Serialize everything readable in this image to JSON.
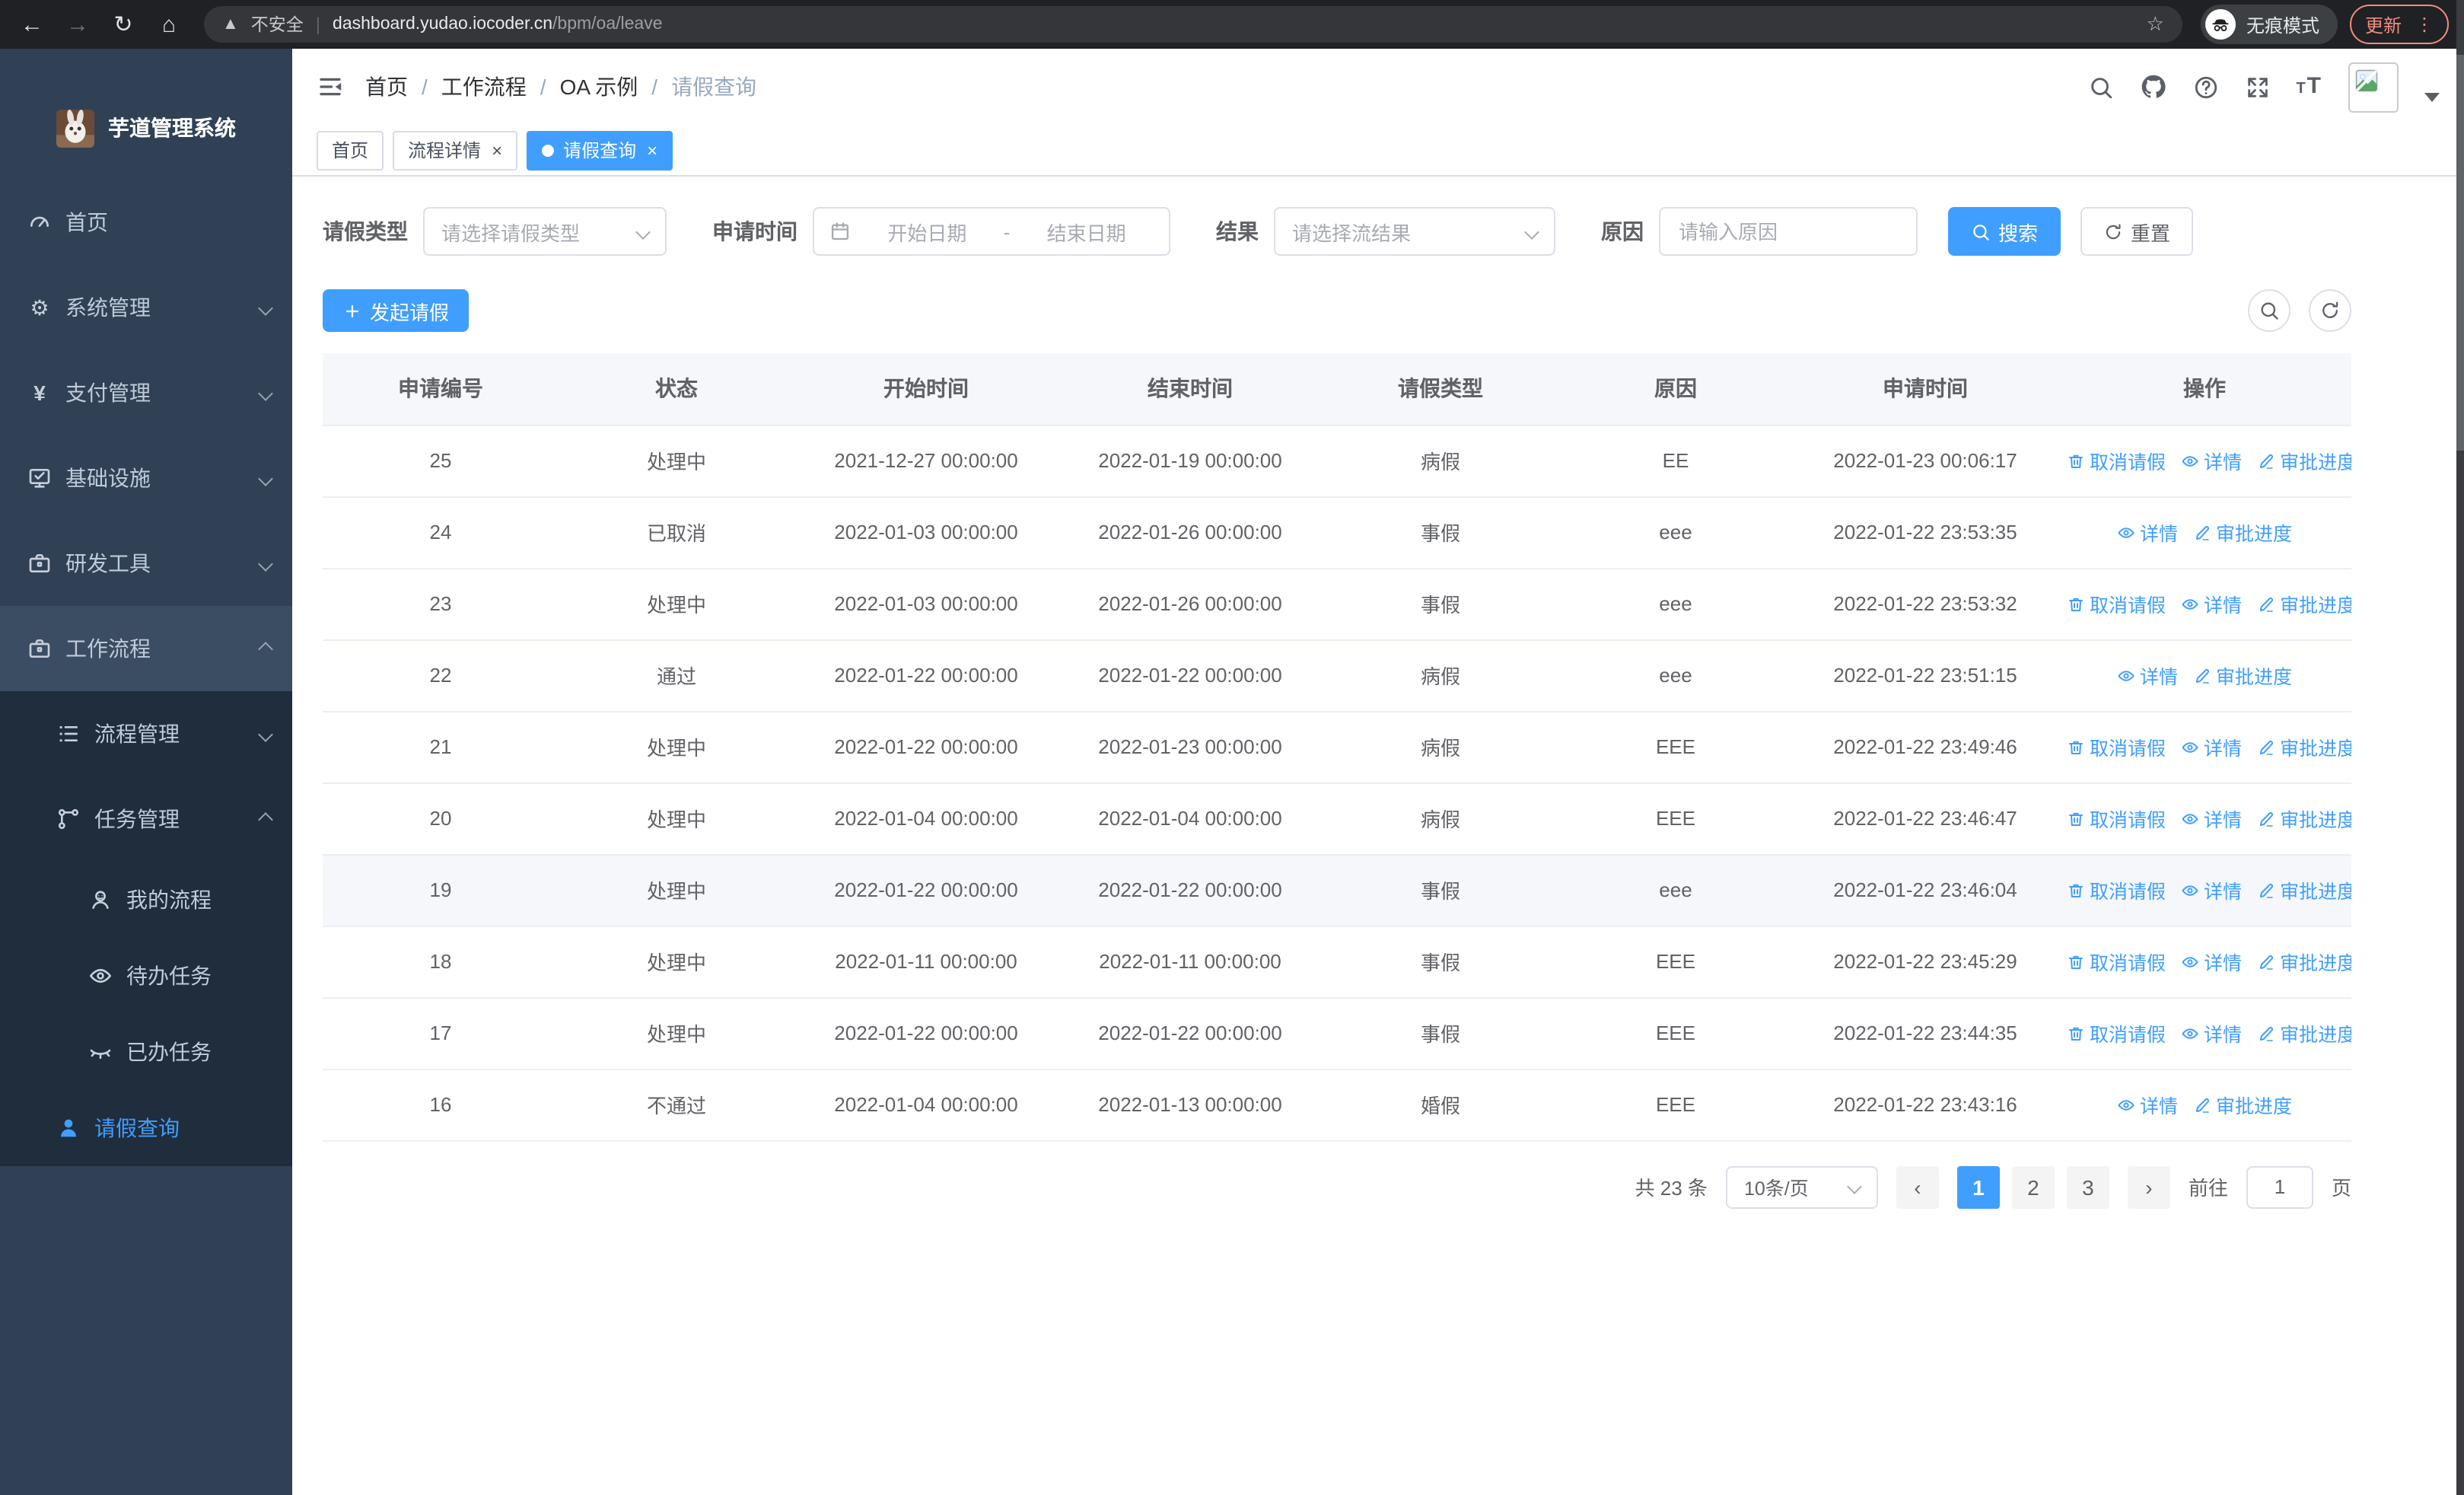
{
  "browser": {
    "security_label": "不安全",
    "url_host": "dashboard.yudao.iocoder.cn",
    "url_path": "/bpm/oa/leave",
    "incognito_label": "无痕模式",
    "update_label": "更新"
  },
  "sidebar": {
    "title": "芋道管理系统",
    "items": [
      {
        "id": "home",
        "label": "首页",
        "icon": "dashboard-icon",
        "level": 1
      },
      {
        "id": "system",
        "label": "系统管理",
        "icon": "gear-icon",
        "level": 1,
        "chevron": "down"
      },
      {
        "id": "payment",
        "label": "支付管理",
        "icon": "yen-icon",
        "level": 1,
        "chevron": "down"
      },
      {
        "id": "infra",
        "label": "基础设施",
        "icon": "monitor-icon",
        "level": 1,
        "chevron": "down"
      },
      {
        "id": "devtools",
        "label": "研发工具",
        "icon": "briefcase-icon",
        "level": 1,
        "chevron": "down"
      },
      {
        "id": "workflow",
        "label": "工作流程",
        "icon": "briefcase-icon",
        "level": 1,
        "chevron": "up",
        "highlighted": true
      },
      {
        "id": "process-mgmt",
        "label": "流程管理",
        "icon": "list-tree-icon",
        "level": 2,
        "chevron": "down",
        "sub": true
      },
      {
        "id": "task-mgmt",
        "label": "任务管理",
        "icon": "flow-icon",
        "level": 2,
        "chevron": "up",
        "sub": true
      },
      {
        "id": "my-process",
        "label": "我的流程",
        "icon": "person-icon",
        "level": 3,
        "sub": true
      },
      {
        "id": "todo-task",
        "label": "待办任务",
        "icon": "eye-open-icon",
        "level": 3,
        "sub": true
      },
      {
        "id": "done-task",
        "label": "已办任务",
        "icon": "eye-closed-icon",
        "level": 3,
        "sub": true
      },
      {
        "id": "leave-query",
        "label": "请假查询",
        "icon": "user-icon",
        "level": 2,
        "sub": true,
        "active": true
      }
    ]
  },
  "navbar": {
    "breadcrumb": [
      {
        "label": "首页"
      },
      {
        "label": "工作流程"
      },
      {
        "label": "OA 示例"
      },
      {
        "label": "请假查询",
        "current": true
      }
    ]
  },
  "tags": [
    {
      "label": "首页"
    },
    {
      "label": "流程详情",
      "closable": true
    },
    {
      "label": "请假查询",
      "closable": true,
      "active": true
    }
  ],
  "filters": {
    "leave_type": {
      "label": "请假类型",
      "placeholder": "请选择请假类型"
    },
    "apply_time": {
      "label": "申请时间",
      "start_placeholder": "开始日期",
      "separator": "-",
      "end_placeholder": "结束日期"
    },
    "result": {
      "label": "结果",
      "placeholder": "请选择流结果"
    },
    "reason": {
      "label": "原因",
      "placeholder": "请输入原因"
    },
    "search_label": "搜索",
    "reset_label": "重置"
  },
  "toolbar": {
    "create_label": "发起请假"
  },
  "table": {
    "columns": [
      "申请编号",
      "状态",
      "开始时间",
      "结束时间",
      "请假类型",
      "原因",
      "申请时间",
      "操作"
    ],
    "action_defs": {
      "cancel": {
        "label": "取消请假",
        "icon": "delete-icon"
      },
      "detail": {
        "label": "详情",
        "icon": "view-icon"
      },
      "progress": {
        "label": "审批进度",
        "icon": "edit-icon"
      }
    },
    "rows": [
      {
        "id": "25",
        "status": "处理中",
        "start": "2021-12-27 00:00:00",
        "end": "2022-01-19 00:00:00",
        "type": "病假",
        "reason": "EE",
        "apply": "2022-01-23 00:06:17",
        "actions": [
          "cancel",
          "detail",
          "progress"
        ]
      },
      {
        "id": "24",
        "status": "已取消",
        "start": "2022-01-03 00:00:00",
        "end": "2022-01-26 00:00:00",
        "type": "事假",
        "reason": "eee",
        "apply": "2022-01-22 23:53:35",
        "actions": [
          "detail",
          "progress"
        ]
      },
      {
        "id": "23",
        "status": "处理中",
        "start": "2022-01-03 00:00:00",
        "end": "2022-01-26 00:00:00",
        "type": "事假",
        "reason": "eee",
        "apply": "2022-01-22 23:53:32",
        "actions": [
          "cancel",
          "detail",
          "progress"
        ]
      },
      {
        "id": "22",
        "status": "通过",
        "start": "2022-01-22 00:00:00",
        "end": "2022-01-22 00:00:00",
        "type": "病假",
        "reason": "eee",
        "apply": "2022-01-22 23:51:15",
        "actions": [
          "detail",
          "progress"
        ]
      },
      {
        "id": "21",
        "status": "处理中",
        "start": "2022-01-22 00:00:00",
        "end": "2022-01-23 00:00:00",
        "type": "病假",
        "reason": "EEE",
        "apply": "2022-01-22 23:49:46",
        "actions": [
          "cancel",
          "detail",
          "progress"
        ]
      },
      {
        "id": "20",
        "status": "处理中",
        "start": "2022-01-04 00:00:00",
        "end": "2022-01-04 00:00:00",
        "type": "病假",
        "reason": "EEE",
        "apply": "2022-01-22 23:46:47",
        "actions": [
          "cancel",
          "detail",
          "progress"
        ]
      },
      {
        "id": "19",
        "status": "处理中",
        "start": "2022-01-22 00:00:00",
        "end": "2022-01-22 00:00:00",
        "type": "事假",
        "reason": "eee",
        "apply": "2022-01-22 23:46:04",
        "actions": [
          "cancel",
          "detail",
          "progress"
        ],
        "highlighted": true
      },
      {
        "id": "18",
        "status": "处理中",
        "start": "2022-01-11 00:00:00",
        "end": "2022-01-11 00:00:00",
        "type": "事假",
        "reason": "EEE",
        "apply": "2022-01-22 23:45:29",
        "actions": [
          "cancel",
          "detail",
          "progress"
        ]
      },
      {
        "id": "17",
        "status": "处理中",
        "start": "2022-01-22 00:00:00",
        "end": "2022-01-22 00:00:00",
        "type": "事假",
        "reason": "EEE",
        "apply": "2022-01-22 23:44:35",
        "actions": [
          "cancel",
          "detail",
          "progress"
        ]
      },
      {
        "id": "16",
        "status": "不通过",
        "start": "2022-01-04 00:00:00",
        "end": "2022-01-13 00:00:00",
        "type": "婚假",
        "reason": "EEE",
        "apply": "2022-01-22 23:43:16",
        "actions": [
          "detail",
          "progress"
        ]
      }
    ]
  },
  "pagination": {
    "total_label": "共 23 条",
    "page_size": "10条/页",
    "pages": [
      "1",
      "2",
      "3"
    ],
    "active_page": "1",
    "prev_glyph": "‹",
    "next_glyph": "›",
    "goto_label": "前往",
    "jump_value": "1",
    "page_unit": "页"
  },
  "colors": {
    "accent": "#409eff",
    "sidebar_bg": "#304156",
    "submenu_bg": "#1f2d3d",
    "chrome_bg": "#202124",
    "update_color": "#f28b82"
  }
}
